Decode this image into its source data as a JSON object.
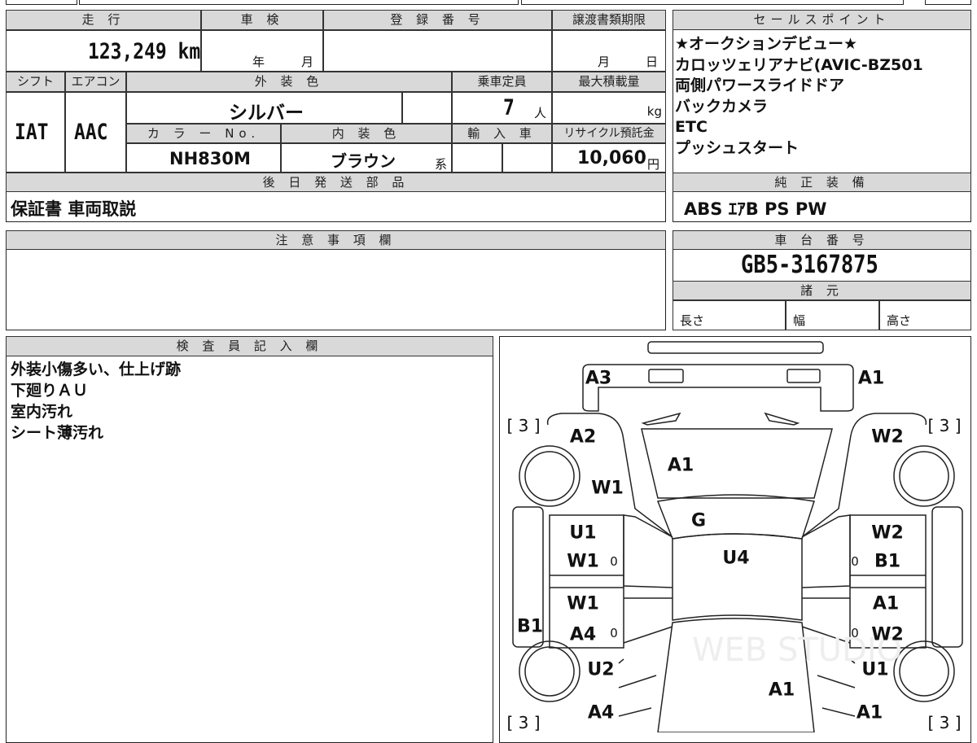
{
  "vehicle": {
    "headers": {
      "mileage": "走 行",
      "inspection": "車 検",
      "registration": "登 録 番 号",
      "transfer_deadline": "譲渡書類期限",
      "shift": "シフト",
      "aircon": "エアコン",
      "exterior_color": "外 装 色",
      "capacity": "乗車定員",
      "max_load": "最大積載量",
      "color_no": "カ ラ ー No.",
      "interior_color": "内 装 色",
      "import": "輸 入 車",
      "recycle": "リサイクル預託金",
      "parts_later": "後 日 発 送 部 品"
    },
    "mileage": "123,249 km",
    "inspection_year": "年",
    "inspection_month": "月",
    "deadline_month": "月",
    "deadline_day": "日",
    "shift": "IAT",
    "aircon": "AAC",
    "exterior_color": "シルバー",
    "capacity": "7",
    "capacity_unit": "人",
    "max_load_unit": "kg",
    "color_no": "NH830M",
    "interior_color": "ブラウン",
    "interior_suffix": "系",
    "recycle": "10,060",
    "recycle_unit": "円",
    "parts_later": "保証書 車両取説"
  },
  "sales": {
    "header": "セールスポイント",
    "items": [
      "★オークションデビュー★",
      "カロッツェリアナビ(AVIC-BZ501",
      "両側パワースライドドア",
      "バックカメラ",
      "ETC",
      "プッシュスタート"
    ]
  },
  "equipment": {
    "header": "純 正 装 備",
    "value": "ABS ｴｱB PS PW"
  },
  "notes": {
    "header": "注 意 事 項 欄"
  },
  "chassis": {
    "header": "車 台 番 号",
    "value": "GB5-3167875",
    "spec_header": "諸 元",
    "length": "長さ",
    "width": "幅",
    "height": "高さ"
  },
  "inspector": {
    "header": "検 査 員 記 入 欄",
    "lines": [
      "外装小傷多い、仕上げ跡",
      "下廻りＡＵ",
      "室内汚れ",
      "シート薄汚れ"
    ]
  },
  "diagram": {
    "labels": [
      "A3",
      "A1",
      "[ 3 ]",
      "[ 3 ]",
      "A2",
      "W2",
      "A1",
      "W1",
      "G",
      "U1",
      "W2",
      "W1",
      "0",
      "U4",
      "0",
      "B1",
      "W1",
      "A1",
      "B1",
      "A4",
      "0",
      "0",
      "W2",
      "U2",
      "U1",
      "A1",
      "A4",
      "A1",
      "[ 3 ]",
      "[ 3 ]"
    ],
    "watermark": "WEB STUDIO"
  }
}
